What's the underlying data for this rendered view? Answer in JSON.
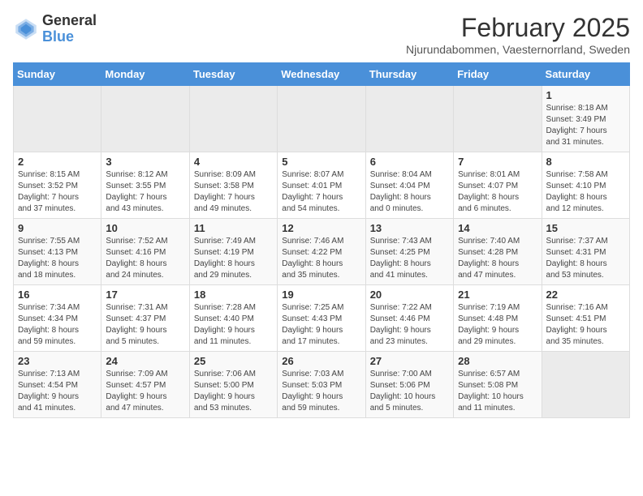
{
  "header": {
    "logo_line1": "General",
    "logo_line2": "Blue",
    "month_title": "February 2025",
    "subtitle": "Njurundabommen, Vaesternorrland, Sweden"
  },
  "days_of_week": [
    "Sunday",
    "Monday",
    "Tuesday",
    "Wednesday",
    "Thursday",
    "Friday",
    "Saturday"
  ],
  "weeks": [
    [
      {
        "day": "",
        "info": ""
      },
      {
        "day": "",
        "info": ""
      },
      {
        "day": "",
        "info": ""
      },
      {
        "day": "",
        "info": ""
      },
      {
        "day": "",
        "info": ""
      },
      {
        "day": "",
        "info": ""
      },
      {
        "day": "1",
        "info": "Sunrise: 8:18 AM\nSunset: 3:49 PM\nDaylight: 7 hours\nand 31 minutes."
      }
    ],
    [
      {
        "day": "2",
        "info": "Sunrise: 8:15 AM\nSunset: 3:52 PM\nDaylight: 7 hours\nand 37 minutes."
      },
      {
        "day": "3",
        "info": "Sunrise: 8:12 AM\nSunset: 3:55 PM\nDaylight: 7 hours\nand 43 minutes."
      },
      {
        "day": "4",
        "info": "Sunrise: 8:09 AM\nSunset: 3:58 PM\nDaylight: 7 hours\nand 49 minutes."
      },
      {
        "day": "5",
        "info": "Sunrise: 8:07 AM\nSunset: 4:01 PM\nDaylight: 7 hours\nand 54 minutes."
      },
      {
        "day": "6",
        "info": "Sunrise: 8:04 AM\nSunset: 4:04 PM\nDaylight: 8 hours\nand 0 minutes."
      },
      {
        "day": "7",
        "info": "Sunrise: 8:01 AM\nSunset: 4:07 PM\nDaylight: 8 hours\nand 6 minutes."
      },
      {
        "day": "8",
        "info": "Sunrise: 7:58 AM\nSunset: 4:10 PM\nDaylight: 8 hours\nand 12 minutes."
      }
    ],
    [
      {
        "day": "9",
        "info": "Sunrise: 7:55 AM\nSunset: 4:13 PM\nDaylight: 8 hours\nand 18 minutes."
      },
      {
        "day": "10",
        "info": "Sunrise: 7:52 AM\nSunset: 4:16 PM\nDaylight: 8 hours\nand 24 minutes."
      },
      {
        "day": "11",
        "info": "Sunrise: 7:49 AM\nSunset: 4:19 PM\nDaylight: 8 hours\nand 29 minutes."
      },
      {
        "day": "12",
        "info": "Sunrise: 7:46 AM\nSunset: 4:22 PM\nDaylight: 8 hours\nand 35 minutes."
      },
      {
        "day": "13",
        "info": "Sunrise: 7:43 AM\nSunset: 4:25 PM\nDaylight: 8 hours\nand 41 minutes."
      },
      {
        "day": "14",
        "info": "Sunrise: 7:40 AM\nSunset: 4:28 PM\nDaylight: 8 hours\nand 47 minutes."
      },
      {
        "day": "15",
        "info": "Sunrise: 7:37 AM\nSunset: 4:31 PM\nDaylight: 8 hours\nand 53 minutes."
      }
    ],
    [
      {
        "day": "16",
        "info": "Sunrise: 7:34 AM\nSunset: 4:34 PM\nDaylight: 8 hours\nand 59 minutes."
      },
      {
        "day": "17",
        "info": "Sunrise: 7:31 AM\nSunset: 4:37 PM\nDaylight: 9 hours\nand 5 minutes."
      },
      {
        "day": "18",
        "info": "Sunrise: 7:28 AM\nSunset: 4:40 PM\nDaylight: 9 hours\nand 11 minutes."
      },
      {
        "day": "19",
        "info": "Sunrise: 7:25 AM\nSunset: 4:43 PM\nDaylight: 9 hours\nand 17 minutes."
      },
      {
        "day": "20",
        "info": "Sunrise: 7:22 AM\nSunset: 4:46 PM\nDaylight: 9 hours\nand 23 minutes."
      },
      {
        "day": "21",
        "info": "Sunrise: 7:19 AM\nSunset: 4:48 PM\nDaylight: 9 hours\nand 29 minutes."
      },
      {
        "day": "22",
        "info": "Sunrise: 7:16 AM\nSunset: 4:51 PM\nDaylight: 9 hours\nand 35 minutes."
      }
    ],
    [
      {
        "day": "23",
        "info": "Sunrise: 7:13 AM\nSunset: 4:54 PM\nDaylight: 9 hours\nand 41 minutes."
      },
      {
        "day": "24",
        "info": "Sunrise: 7:09 AM\nSunset: 4:57 PM\nDaylight: 9 hours\nand 47 minutes."
      },
      {
        "day": "25",
        "info": "Sunrise: 7:06 AM\nSunset: 5:00 PM\nDaylight: 9 hours\nand 53 minutes."
      },
      {
        "day": "26",
        "info": "Sunrise: 7:03 AM\nSunset: 5:03 PM\nDaylight: 9 hours\nand 59 minutes."
      },
      {
        "day": "27",
        "info": "Sunrise: 7:00 AM\nSunset: 5:06 PM\nDaylight: 10 hours\nand 5 minutes."
      },
      {
        "day": "28",
        "info": "Sunrise: 6:57 AM\nSunset: 5:08 PM\nDaylight: 10 hours\nand 11 minutes."
      },
      {
        "day": "",
        "info": ""
      }
    ]
  ]
}
